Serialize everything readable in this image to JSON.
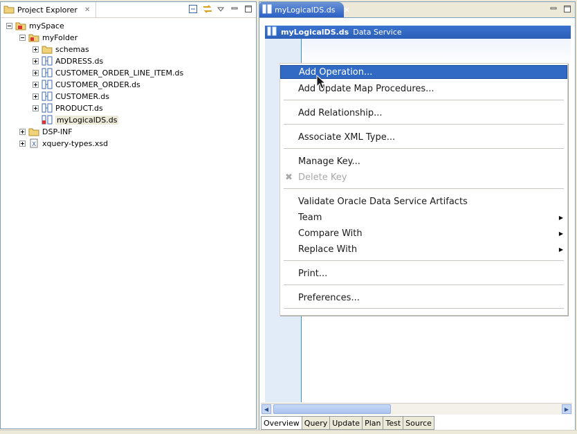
{
  "project_explorer": {
    "title": "Project Explorer",
    "tree": [
      {
        "label": "mySpace",
        "level": 0,
        "expanded": true
      },
      {
        "label": "myFolder",
        "level": 1,
        "expanded": true
      },
      {
        "label": "schemas",
        "level": 2,
        "expanded": false
      },
      {
        "label": "ADDRESS.ds",
        "level": 2,
        "expanded": false
      },
      {
        "label": "CUSTOMER_ORDER_LINE_ITEM.ds",
        "level": 2,
        "expanded": false
      },
      {
        "label": "CUSTOMER_ORDER.ds",
        "level": 2,
        "expanded": false
      },
      {
        "label": "CUSTOMER.ds",
        "level": 2,
        "expanded": false
      },
      {
        "label": "PRODUCT.ds",
        "level": 2,
        "expanded": false
      },
      {
        "label": "myLogicalDS.ds",
        "level": 2,
        "selected": true
      },
      {
        "label": "DSP-INF",
        "level": 1,
        "expanded": false
      },
      {
        "label": "xquery-types.xsd",
        "level": 1,
        "expanded": false
      }
    ]
  },
  "editor": {
    "tab_label": "myLogicalDS.ds",
    "banner_name": "myLogicalDS.ds",
    "banner_type": "Data Service",
    "bottom_tabs": [
      "Overview",
      "Query",
      "Update",
      "Plan",
      "Test",
      "Source"
    ]
  },
  "context_menu": {
    "items": {
      "add_operation": "Add Operation...",
      "add_update_map": "Add Update Map Procedures...",
      "add_relationship": "Add Relationship...",
      "associate_xml": "Associate XML Type...",
      "manage_key": "Manage Key...",
      "delete_key": "Delete Key",
      "validate": "Validate Oracle Data Service Artifacts",
      "team": "Team",
      "compare_with": "Compare With",
      "replace_with": "Replace With",
      "print": "Print...",
      "preferences": "Preferences..."
    }
  },
  "colors": {
    "accent": "#316ac5",
    "tab_active": "#2a60c6"
  }
}
